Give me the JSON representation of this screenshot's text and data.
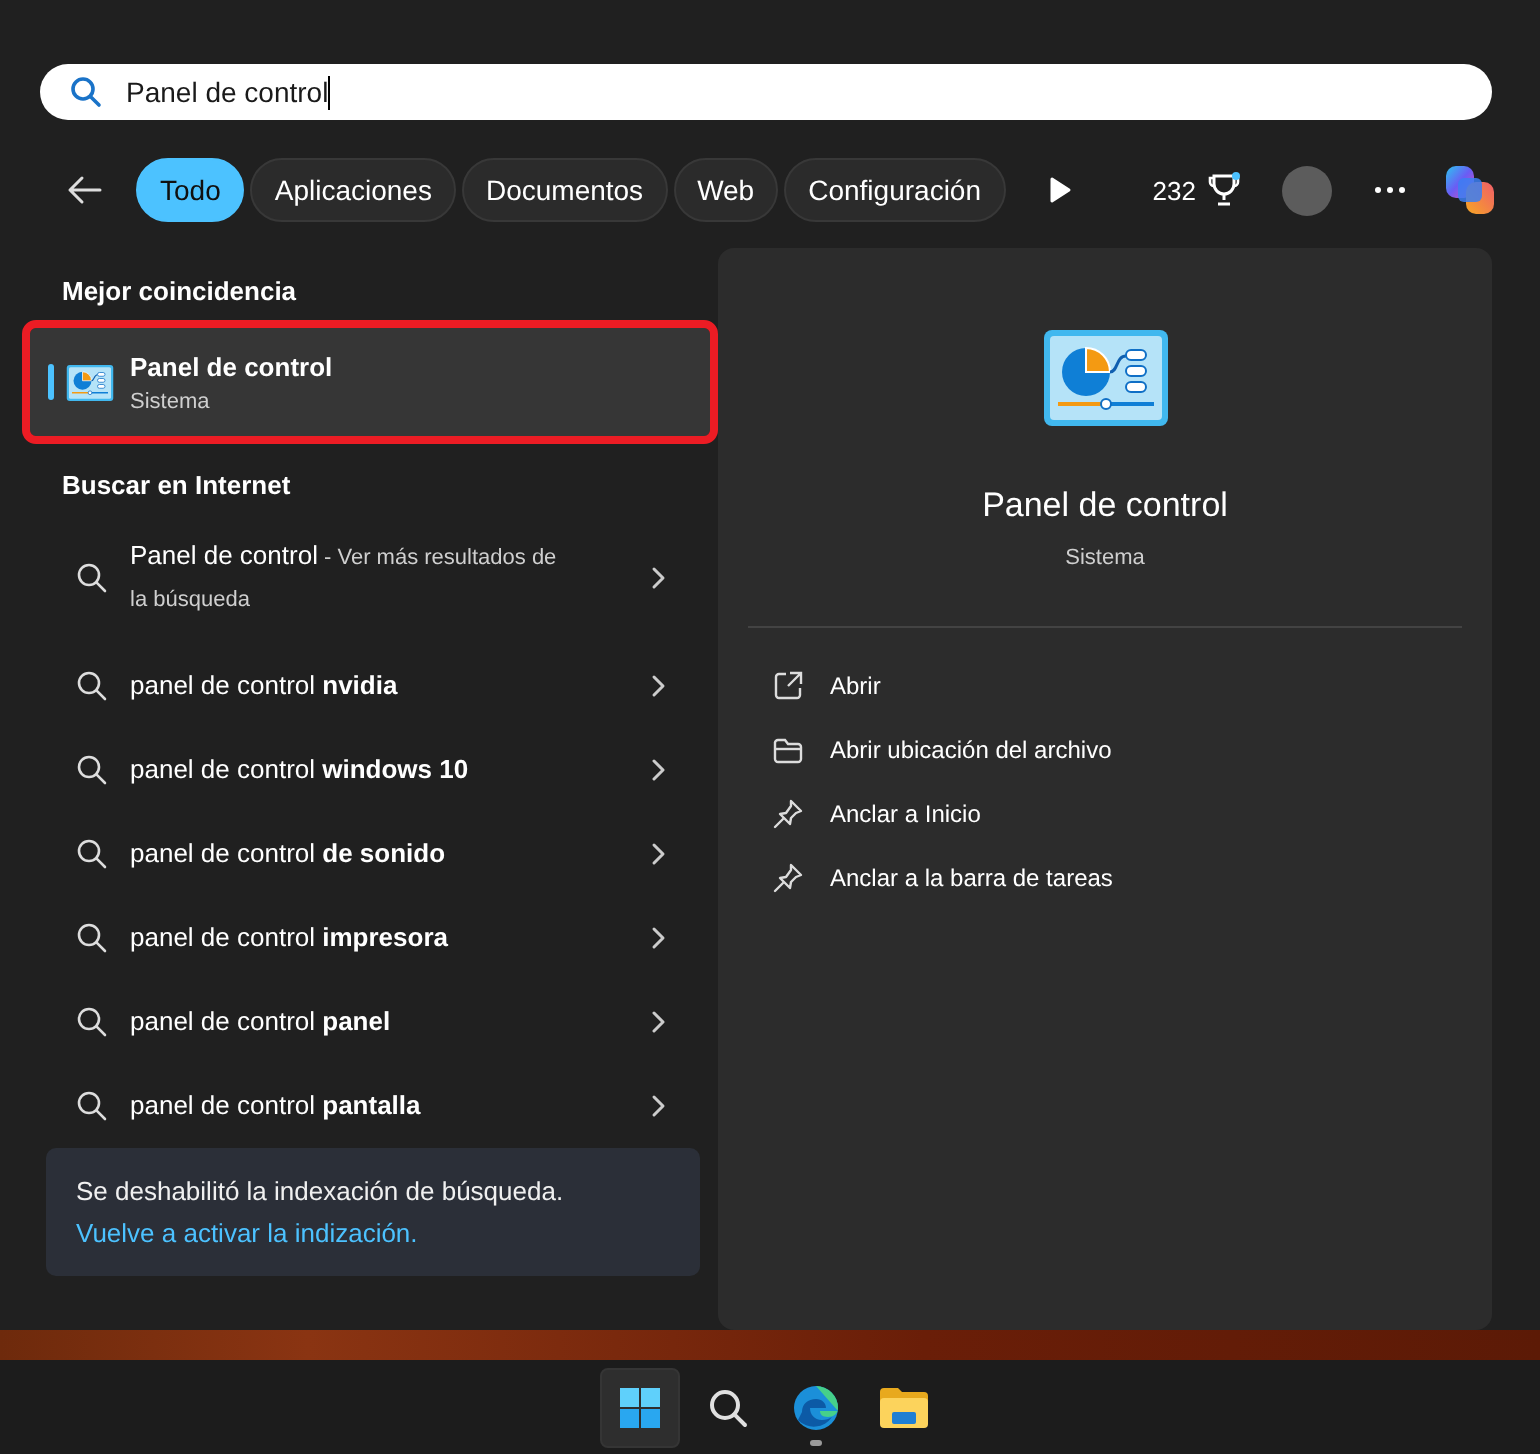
{
  "search": {
    "value": "Panel de control"
  },
  "filters": [
    {
      "label": "Todo",
      "selected": true
    },
    {
      "label": "Aplicaciones",
      "selected": false
    },
    {
      "label": "Documentos",
      "selected": false
    },
    {
      "label": "Web",
      "selected": false
    },
    {
      "label": "Configuración",
      "selected": false
    }
  ],
  "points": "232",
  "best_match": {
    "heading": "Mejor coincidencia",
    "title": "Panel de control",
    "subtitle": "Sistema",
    "selected": true,
    "highlighted": true
  },
  "web": {
    "heading": "Buscar en Internet",
    "results": [
      {
        "text": "Panel de control",
        "note": " - Ver más resultados de la búsqueda"
      },
      {
        "text": "panel de control **nvidia**"
      },
      {
        "text": "panel de control **windows 10**"
      },
      {
        "text": "panel de control **de sonido**"
      },
      {
        "text": "panel de control **impresora**"
      },
      {
        "text": "panel de control **panel**"
      },
      {
        "text": "panel de control **pantalla**"
      }
    ]
  },
  "notice": {
    "text": "Se deshabilitó la indexación de búsqueda.",
    "link": "Vuelve a activar la indización."
  },
  "preview": {
    "title": "Panel de control",
    "subtitle": "Sistema",
    "actions": [
      {
        "kind": "open",
        "label": "Abrir"
      },
      {
        "kind": "folder",
        "label": "Abrir ubicación del archivo"
      },
      {
        "kind": "pin",
        "label": "Anclar a Inicio"
      },
      {
        "kind": "pin",
        "label": "Anclar a la barra de tareas"
      }
    ]
  },
  "taskbar": [
    {
      "kind": "start",
      "selected": true
    },
    {
      "kind": "search",
      "selected": false
    },
    {
      "kind": "browser",
      "selected": false,
      "running": true
    },
    {
      "kind": "explorer",
      "selected": false
    }
  ]
}
